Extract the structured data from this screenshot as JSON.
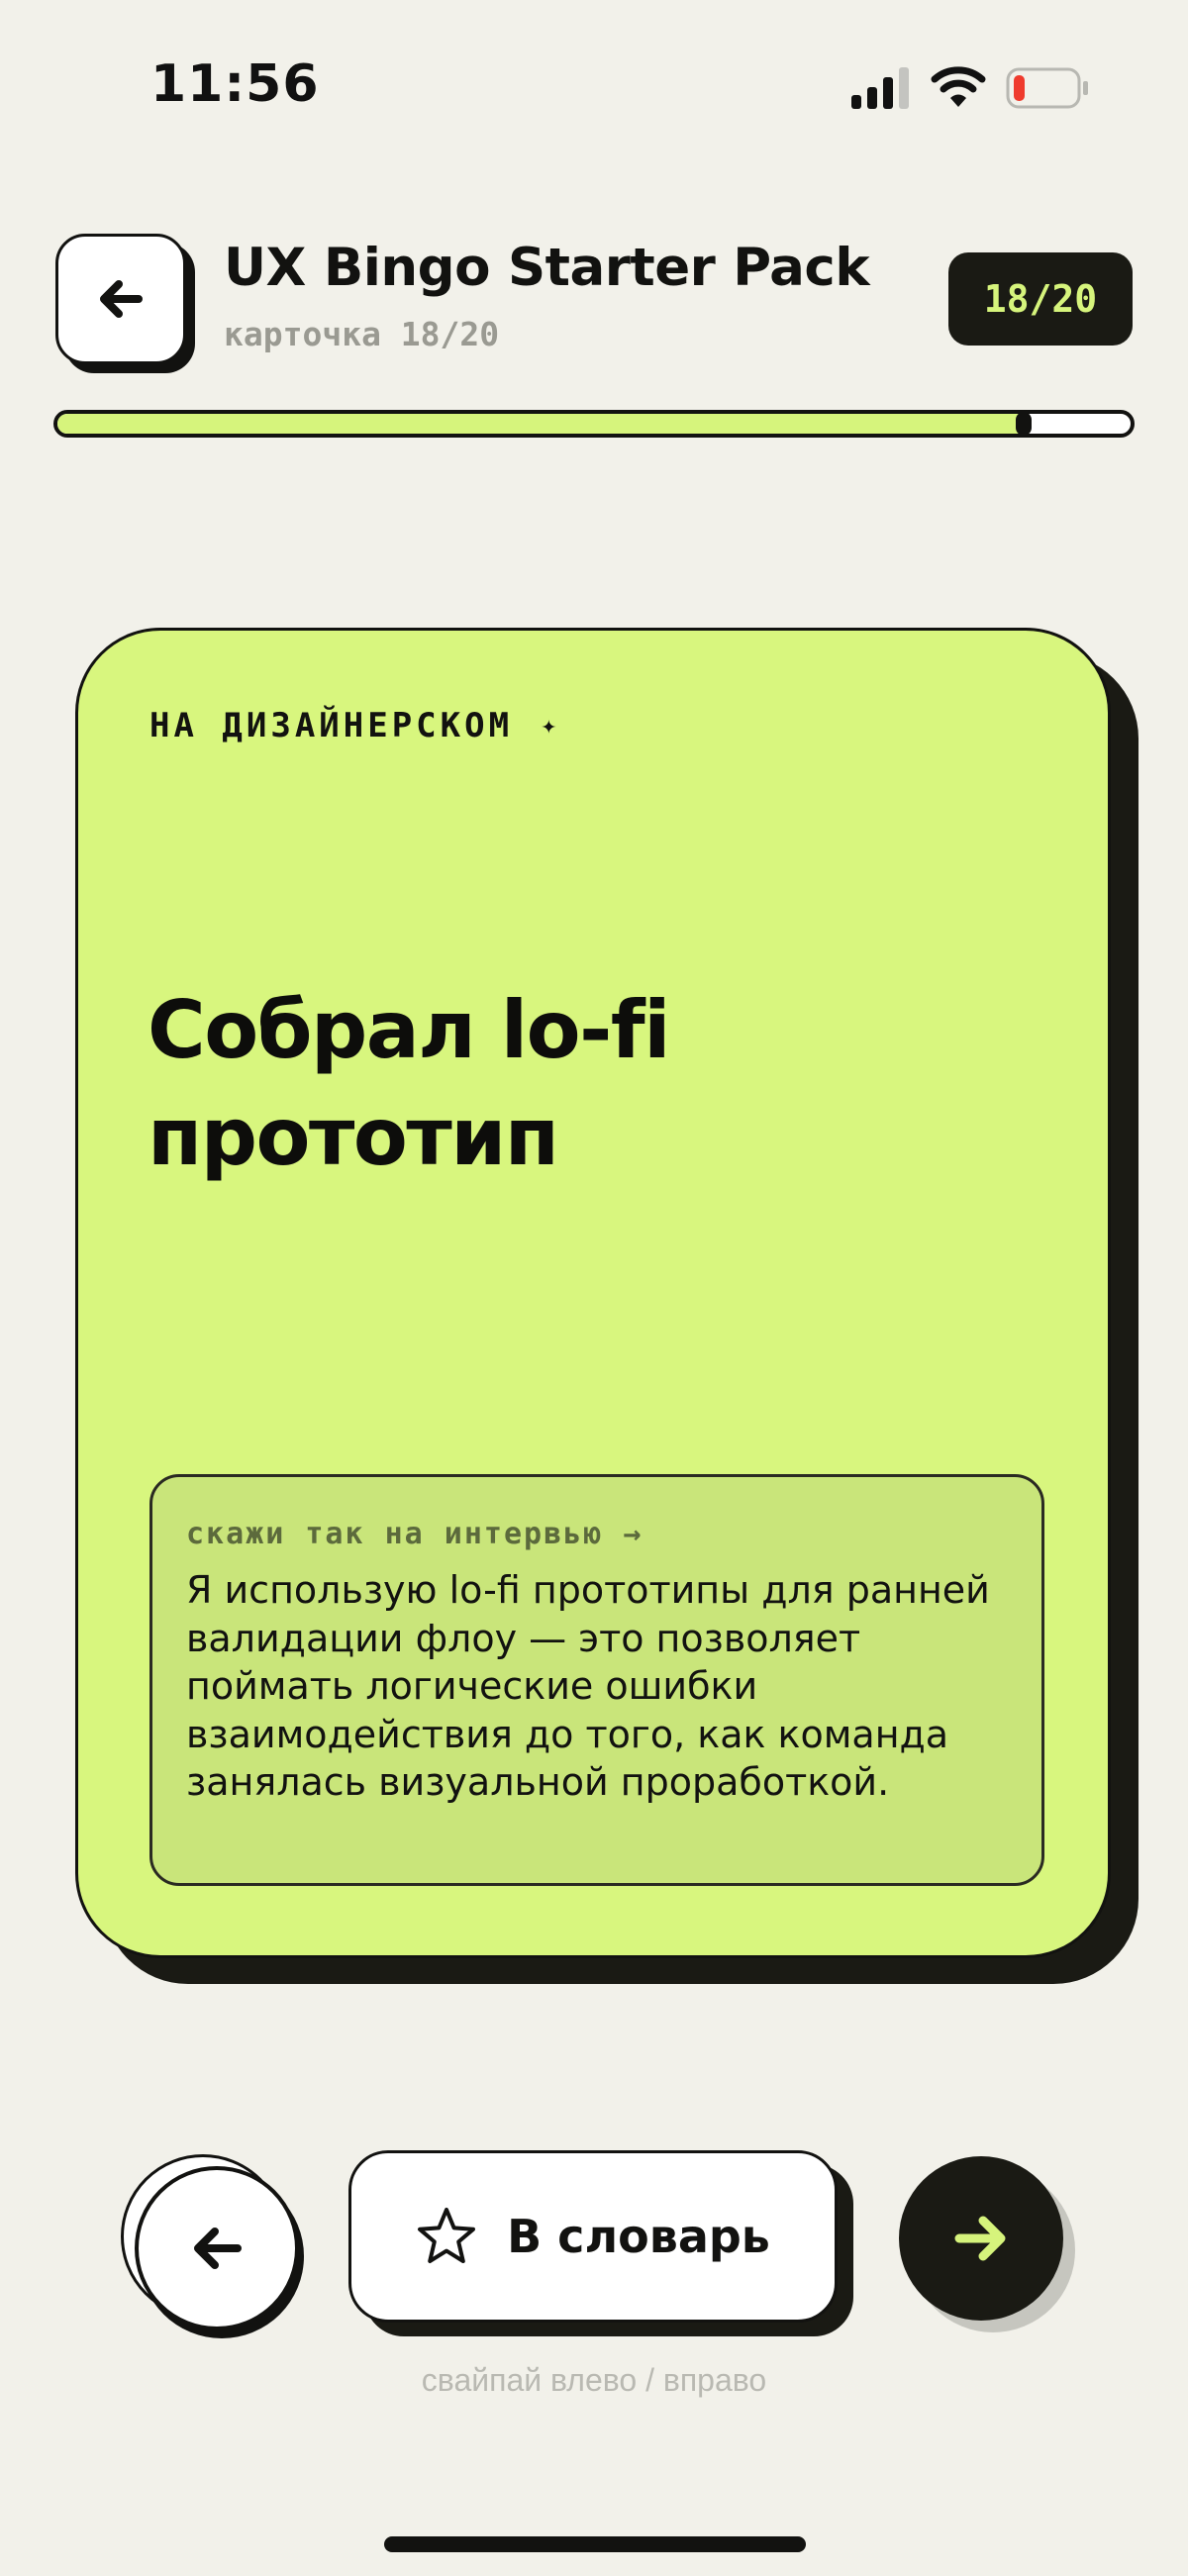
{
  "status_bar": {
    "time": "11:56"
  },
  "header": {
    "back_icon": "arrow-left-icon",
    "title": "UX Bingo Starter Pack",
    "subtitle": "карточка 18/20",
    "count_badge": "18/20"
  },
  "progress": {
    "current": 18,
    "total": 20,
    "fraction": 0.9
  },
  "card": {
    "tag": "НА ДИЗАЙНЕРСКОМ",
    "tag_icon": "✦",
    "title": "Собрал lo-fi прототип",
    "tip_label": "скажи так на интервью →",
    "tip_text": "Я использую lo-fi прототипы для ранней валидации флоу — это позволяет поймать логические ошибки взаимодействия до того, как команда занялась визуальной проработкой."
  },
  "controls": {
    "dictionary_label": "В словарь",
    "dictionary_icon": "star-outline-icon",
    "prev_icon": "arrow-left-icon",
    "next_icon": "arrow-right-icon",
    "swipe_hint": "свайпай влево / вправо"
  },
  "colors": {
    "background": "#f2f1ea",
    "accent_lime": "#d8f67e",
    "dark": "#121210",
    "muted_text": "#9a9a92"
  }
}
